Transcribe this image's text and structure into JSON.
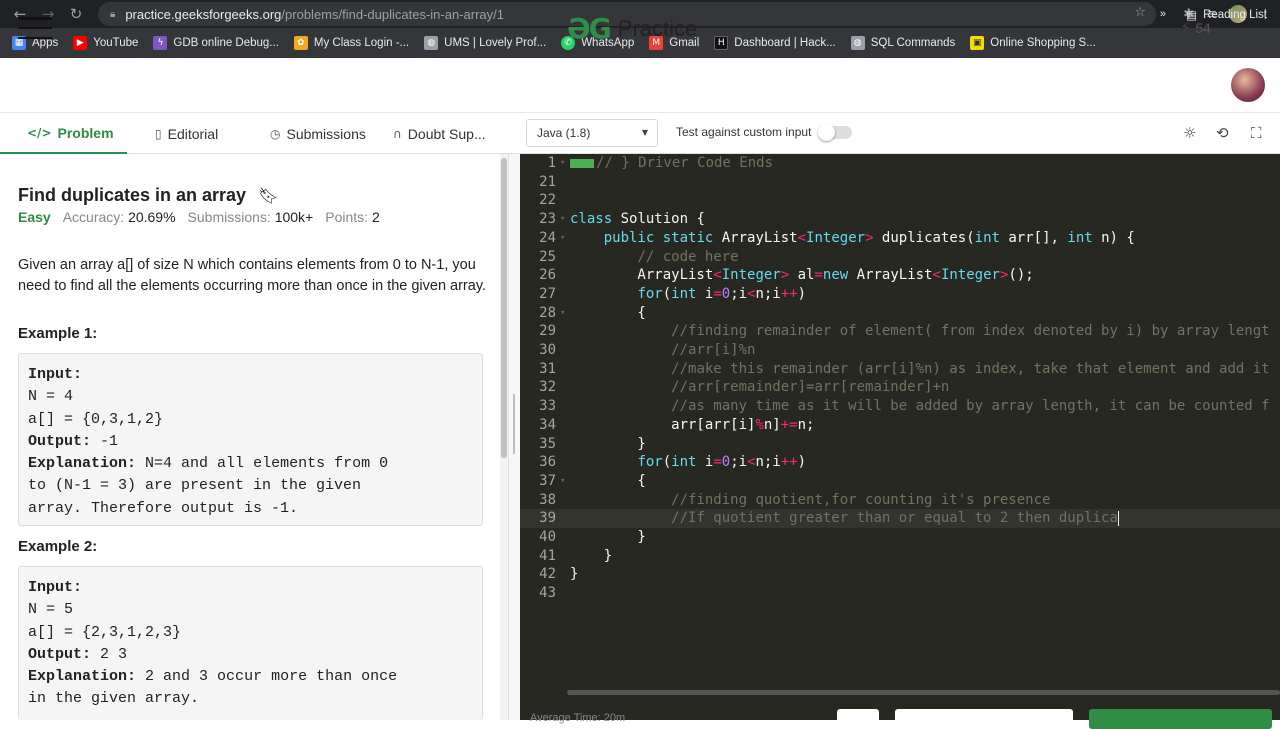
{
  "browser": {
    "url_host": "practice.geeksforgeeks.org",
    "url_path": "/problems/find-duplicates-in-an-array/1",
    "bookmarks": [
      {
        "label": "Apps",
        "icon": "apps-grid-icon",
        "color": "#4285f4"
      },
      {
        "label": "YouTube",
        "icon": "youtube-icon",
        "color": "#ff0000"
      },
      {
        "label": "GDB online Debug...",
        "icon": "gdb-icon",
        "color": "#7e57c2"
      },
      {
        "label": "My Class Login -...",
        "icon": "myclass-icon",
        "color": "#f5a623"
      },
      {
        "label": "UMS | Lovely Prof...",
        "icon": "globe-icon",
        "color": "#9aa0a6"
      },
      {
        "label": "WhatsApp",
        "icon": "whatsapp-icon",
        "color": "#25d366"
      },
      {
        "label": "Gmail",
        "icon": "gmail-icon",
        "color": "#ea4335"
      },
      {
        "label": "Dashboard | Hack...",
        "icon": "hackerrank-icon",
        "color": "#111111"
      },
      {
        "label": "SQL Commands",
        "icon": "globe-icon",
        "color": "#9aa0a6"
      },
      {
        "label": "Online Shopping S...",
        "icon": "shopping-icon",
        "color": "#f0e000"
      }
    ],
    "more": "»",
    "reading_list": "Reading List"
  },
  "header": {
    "brand": "Practice",
    "streak": "54"
  },
  "tabs": [
    {
      "label": "Problem",
      "icon": "code-icon"
    },
    {
      "label": "Editorial",
      "icon": "document-icon"
    },
    {
      "label": "Submissions",
      "icon": "clock-icon"
    },
    {
      "label": "Doubt Sup...",
      "icon": "headset-icon"
    }
  ],
  "editor_toolbar": {
    "language": "Java (1.8)",
    "custom_input_label": "Test against custom input"
  },
  "problem": {
    "title": "Find duplicates in an array",
    "difficulty": "Easy",
    "accuracy_label": "Accuracy:",
    "accuracy": "20.69%",
    "submissions_label": "Submissions:",
    "submissions": "100k+",
    "points_label": "Points:",
    "points": "2",
    "description": "Given an array a[] of size N which contains elements from 0 to N-1, you need to find all the elements occurring more than once in the given array.",
    "examples": [
      {
        "title": "Example 1:",
        "input_label": "Input:",
        "n_line": "N = 4",
        "array_line": "a[] = {0,3,1,2}",
        "output_label": "Output:",
        "output": "-1",
        "explanation_label": "Explanation:",
        "explanation_1": "N=4 and all elements from 0",
        "explanation_2": "to (N-1 = 3) are present in the given",
        "explanation_3": "array. Therefore output is -1."
      },
      {
        "title": "Example 2:",
        "input_label": "Input:",
        "n_line": "N = 5",
        "array_line": "a[] = {2,3,1,2,3}",
        "output_label": "Output:",
        "output": "2 3",
        "explanation_label": "Explanation:",
        "explanation_1": "2 and 3 occur more than once",
        "explanation_2": "in the given array."
      }
    ]
  },
  "code": {
    "lines": [
      {
        "n": "1",
        "text": "// } Driver Code Ends"
      },
      {
        "n": "21",
        "text": ""
      },
      {
        "n": "22",
        "text": ""
      },
      {
        "n": "23",
        "text": "class Solution {"
      },
      {
        "n": "24",
        "text": "    public static ArrayList<Integer> duplicates(int arr[], int n) {"
      },
      {
        "n": "25",
        "text": "        // code here"
      },
      {
        "n": "26",
        "text": "        ArrayList<Integer> al=new ArrayList<Integer>();"
      },
      {
        "n": "27",
        "text": "        for(int i=0;i<n;i++)"
      },
      {
        "n": "28",
        "text": "        {"
      },
      {
        "n": "29",
        "text": "            //finding remainder of element( from index denoted by i) by array lengt"
      },
      {
        "n": "30",
        "text": "            //arr[i]%n"
      },
      {
        "n": "31",
        "text": "            //make this remainder (arr[i]%n) as index, take that element and add it"
      },
      {
        "n": "32",
        "text": "            //arr[remainder]=arr[remainder]+n"
      },
      {
        "n": "33",
        "text": "            //as many time as it will be added by array length, it can be counted f"
      },
      {
        "n": "34",
        "text": "            arr[arr[i]%n]+=n;"
      },
      {
        "n": "35",
        "text": "        }"
      },
      {
        "n": "36",
        "text": "        for(int i=0;i<n;i++)"
      },
      {
        "n": "37",
        "text": "        {"
      },
      {
        "n": "38",
        "text": "            //finding quotient,for counting it's presence"
      },
      {
        "n": "39",
        "text": "            //If quotient greater than or equal to 2 then duplica"
      },
      {
        "n": "40",
        "text": "        }"
      },
      {
        "n": "41",
        "text": "    }"
      },
      {
        "n": "42",
        "text": "}"
      },
      {
        "n": "43",
        "text": ""
      }
    ]
  },
  "footer": {
    "avg_time": "Average Time: 20m"
  },
  "colors": {
    "brand_green": "#2f8d46",
    "editor_bg": "#272822"
  }
}
